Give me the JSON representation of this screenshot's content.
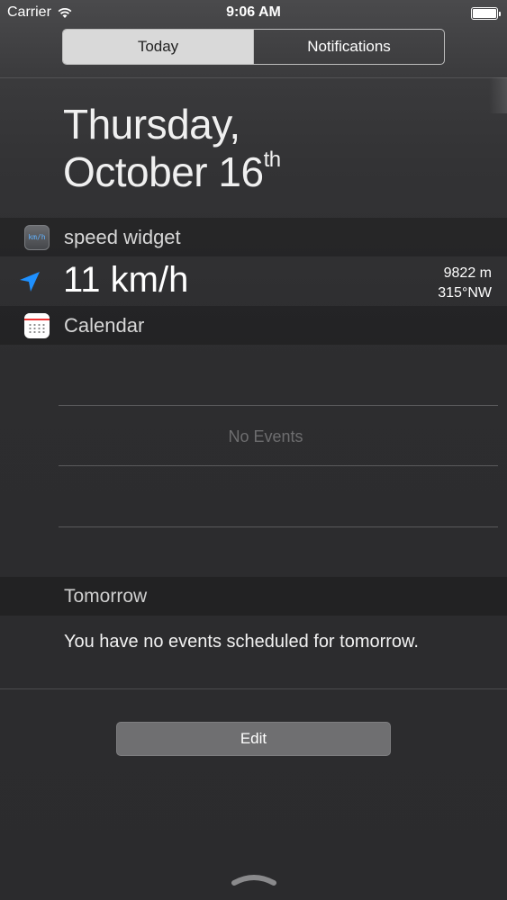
{
  "status_bar": {
    "carrier": "Carrier",
    "time": "9:06 AM"
  },
  "tabs": [
    {
      "label": "Today",
      "selected": true
    },
    {
      "label": "Notifications",
      "selected": false
    }
  ],
  "date": {
    "line1": "Thursday,",
    "line2": "October 16",
    "suffix": "th"
  },
  "speed_widget": {
    "title": "speed widget",
    "app_icon_text": "km/h",
    "speed": "11 km/h",
    "altitude": "9822 m",
    "heading": "315°NW",
    "accent_color": "#1e90ff"
  },
  "calendar_widget": {
    "title": "Calendar",
    "empty_text": "No Events"
  },
  "tomorrow": {
    "title": "Tomorrow",
    "message": "You have no events scheduled for tomorrow."
  },
  "edit_button": {
    "label": "Edit"
  },
  "colors": {
    "segment_selected": "#d9d9d9",
    "background": "#2c2c2e",
    "calendar_icon_accent": "#e33333"
  },
  "icons": {
    "status": [
      "wifi-icon",
      "battery-icon"
    ],
    "speed": "location-arrow-icon",
    "bottom": "grabber-icon"
  }
}
